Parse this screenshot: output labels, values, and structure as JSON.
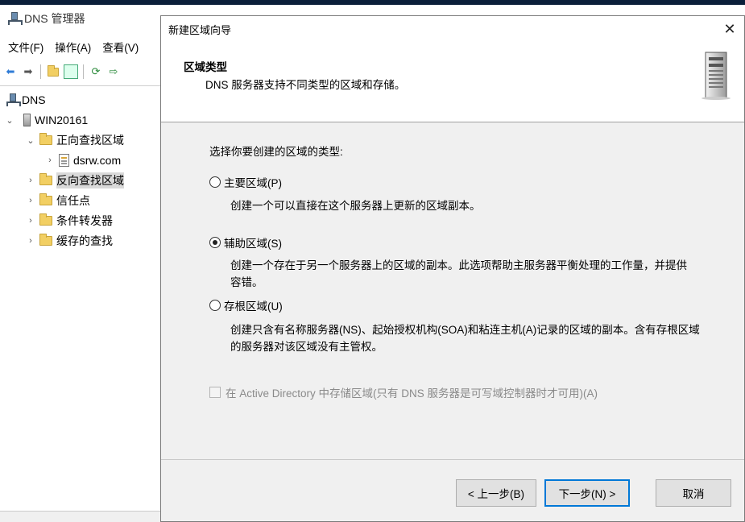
{
  "background_window": {
    "title": "DNS 管理器",
    "menu": [
      "文件(F)",
      "操作(A)",
      "查看(V)"
    ],
    "tree": [
      {
        "label": "DNS",
        "level": 0,
        "icon": "dns-icon",
        "chevron": ""
      },
      {
        "label": "WIN20161",
        "level": 0,
        "icon": "server-icon",
        "chevron": "expanded"
      },
      {
        "label": "正向查找区域",
        "level": 1,
        "icon": "folder-icon",
        "chevron": "expanded"
      },
      {
        "label": "dsrw.com",
        "level": 2,
        "icon": "zone-file-icon",
        "chevron": "collapsed"
      },
      {
        "label": "反向查找区域",
        "level": 1,
        "icon": "folder-icon",
        "chevron": "collapsed",
        "selected": true
      },
      {
        "label": "信任点",
        "level": 1,
        "icon": "folder-icon",
        "chevron": "collapsed"
      },
      {
        "label": "条件转发器",
        "level": 1,
        "icon": "folder-icon",
        "chevron": "collapsed"
      },
      {
        "label": "缓存的查找",
        "level": 1,
        "icon": "folder-icon",
        "chevron": "collapsed"
      }
    ]
  },
  "dialog": {
    "title": "新建区域向导",
    "close_glyph": "✕",
    "header_title": "区域类型",
    "header_subtitle": "DNS 服务器支持不同类型的区域和存储。",
    "prompt": "选择你要创建的区域的类型:",
    "options": [
      {
        "label": "主要区域(P)",
        "checked": false,
        "description": "创建一个可以直接在这个服务器上更新的区域副本。"
      },
      {
        "label": "辅助区域(S)",
        "checked": true,
        "description": "创建一个存在于另一个服务器上的区域的副本。此选项帮助主服务器平衡处理的工作量，并提供容错。"
      },
      {
        "label": "存根区域(U)",
        "checked": false,
        "description": "创建只含有名称服务器(NS)、起始授权机构(SOA)和粘连主机(A)记录的区域的副本。含有存根区域的服务器对该区域没有主管权。"
      }
    ],
    "ad_checkbox_label": "在 Active Directory 中存储区域(只有 DNS 服务器是可写域控制器时才可用)(A)",
    "ad_checkbox_checked": false,
    "ad_checkbox_enabled": false,
    "buttons": {
      "back": "< 上一步(B)",
      "next": "下一步(N) >",
      "cancel": "取消"
    }
  }
}
